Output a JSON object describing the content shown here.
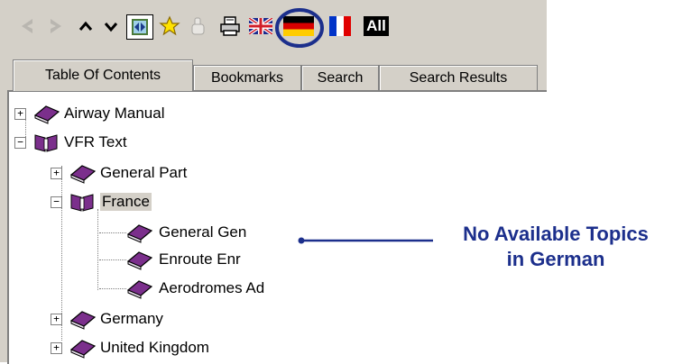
{
  "toolbar": {
    "buttons": [
      {
        "name": "back-button",
        "icon": "chevron-left-icon"
      },
      {
        "name": "forward-button",
        "icon": "chevron-right-icon"
      },
      {
        "name": "up-button",
        "icon": "caret-up-icon"
      },
      {
        "name": "down-button",
        "icon": "caret-down-icon"
      },
      {
        "name": "sync-toc-button",
        "icon": "sync-icon"
      },
      {
        "name": "bookmark-button",
        "icon": "star-icon"
      },
      {
        "name": "highlight-button",
        "icon": "hand-icon"
      },
      {
        "name": "print-button",
        "icon": "printer-icon"
      },
      {
        "name": "english-language-button",
        "icon": "uk-flag-icon"
      },
      {
        "name": "german-language-button",
        "icon": "german-flag-icon"
      },
      {
        "name": "french-language-button",
        "icon": "french-flag-icon"
      }
    ],
    "all_label": "All"
  },
  "tabs": [
    {
      "label": "Table Of Contents",
      "active": true
    },
    {
      "label": "Bookmarks",
      "active": false
    },
    {
      "label": "Search",
      "active": false
    },
    {
      "label": "Search Results",
      "active": false
    }
  ],
  "tree": {
    "airway_manual": "Airway Manual",
    "vfr_text": "VFR Text",
    "general_part": "General Part",
    "france": "France",
    "general_gen": "General Gen",
    "enroute_enr": "Enroute Enr",
    "aerodromes_ad": "Aerodromes Ad",
    "germany": "Germany",
    "united_kingdom": "United Kingdom"
  },
  "annotation": {
    "line1": "No Available Topics",
    "line2": "in German"
  },
  "colors": {
    "annotation": "#1c2f8c",
    "book": "#6b2a7a",
    "panel": "#d4d0c8"
  }
}
